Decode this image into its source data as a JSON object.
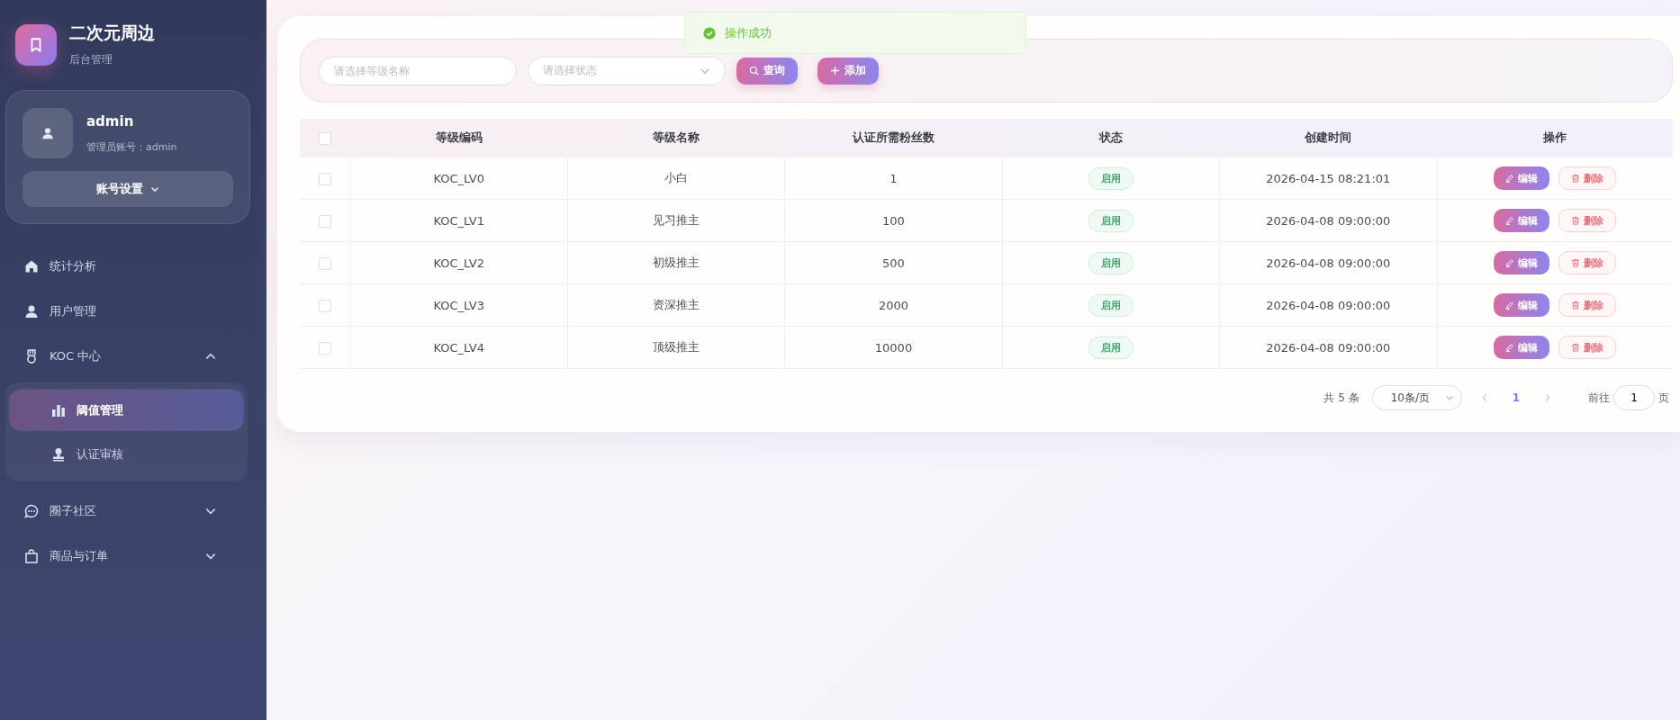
{
  "brand": {
    "title": "二次元周边",
    "subtitle": "后台管理"
  },
  "user": {
    "name": "admin",
    "account": "管理员账号：admin",
    "settings_button": "账号设置"
  },
  "sidebar": {
    "items": [
      {
        "label": "统计分析",
        "kind": "home",
        "selected": false
      },
      {
        "label": "用户管理",
        "kind": "user",
        "selected": false
      },
      {
        "label": "KOC 中心",
        "kind": "medal",
        "selected": false,
        "expanded": true,
        "children": [
          {
            "label": "阈值管理",
            "kind": "chart",
            "selected": true
          },
          {
            "label": "认证审核",
            "kind": "stamp",
            "selected": false
          }
        ]
      },
      {
        "label": "圈子社区",
        "kind": "chat",
        "selected": false,
        "expanded": false
      },
      {
        "label": "商品与订单",
        "kind": "bag",
        "selected": false,
        "expanded": false
      }
    ]
  },
  "toast": {
    "message": "操作成功"
  },
  "filters": {
    "name_placeholder": "请选择等级名称",
    "status_placeholder": "请选择状态",
    "search_button": "查询",
    "add_button": "添加"
  },
  "table": {
    "header_checked": false,
    "columns": [
      "等级编码",
      "等级名称",
      "认证所需粉丝数",
      "状态",
      "创建时间",
      "操作"
    ],
    "rows": [
      {
        "checked": false,
        "code": "KOC_LV0",
        "name": "小白",
        "fans": "1",
        "status": "启用",
        "created": "2026-04-15 08:21:01",
        "edit": "编辑",
        "delete": "删除"
      },
      {
        "checked": false,
        "code": "KOC_LV1",
        "name": "见习推主",
        "fans": "100",
        "status": "启用",
        "created": "2026-04-08 09:00:00",
        "edit": "编辑",
        "delete": "删除"
      },
      {
        "checked": false,
        "code": "KOC_LV2",
        "name": "初级推主",
        "fans": "500",
        "status": "启用",
        "created": "2026-04-08 09:00:00",
        "edit": "编辑",
        "delete": "删除"
      },
      {
        "checked": false,
        "code": "KOC_LV3",
        "name": "资深推主",
        "fans": "2000",
        "status": "启用",
        "created": "2026-04-08 09:00:00",
        "edit": "编辑",
        "delete": "删除"
      },
      {
        "checked": false,
        "code": "KOC_LV4",
        "name": "顶级推主",
        "fans": "10000",
        "status": "启用",
        "created": "2026-04-08 09:00:00",
        "edit": "编辑",
        "delete": "删除"
      }
    ]
  },
  "pagination": {
    "total": "共 5 条",
    "page_size": "10条/页",
    "pages": [
      {
        "label": "1",
        "selected": true
      }
    ],
    "goto_label": "前往",
    "goto_value": "1",
    "page_suffix": "页"
  }
}
